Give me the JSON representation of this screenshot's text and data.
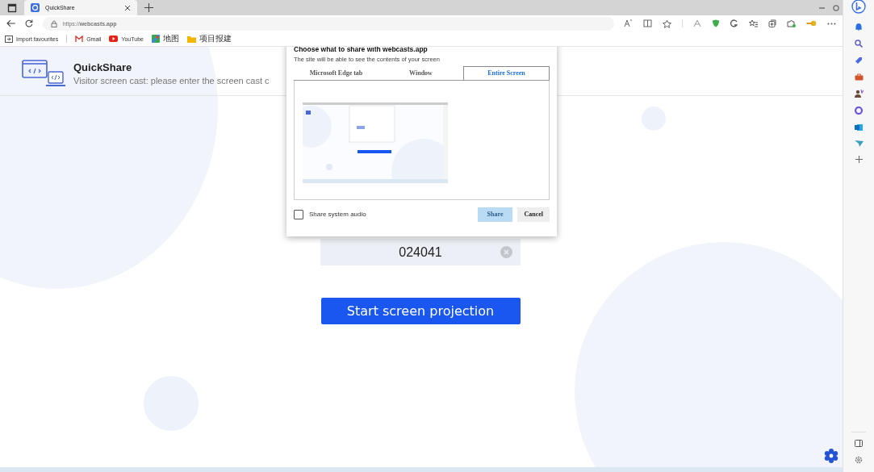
{
  "browser": {
    "tabs": [
      {
        "title": "QuickShare",
        "selected": true
      }
    ],
    "address": "https://**webcasts.app**",
    "bookmarks": [
      {
        "kind": "import",
        "label": "Import favourites"
      },
      {
        "kind": "gmail",
        "label": "Gmail"
      },
      {
        "kind": "youtube",
        "label": "YouTube"
      },
      {
        "kind": "maps",
        "label": "地图"
      },
      {
        "kind": "folder",
        "label": "项目报建"
      }
    ]
  },
  "page": {
    "brand": "QuickShare",
    "subtitle": "Visitor screen cast: please enter the screen cast c",
    "code_field": {
      "value": "024041"
    },
    "start_button": "Start screen projection"
  },
  "dialog": {
    "title": "Choose what to share with webcasts.app",
    "subtitle": "The site will be able to see the contents of your screen",
    "tabs": [
      {
        "label": "Microsoft Edge tab",
        "selected": false
      },
      {
        "label": "Window",
        "selected": false
      },
      {
        "label": "Entire Screen",
        "selected": true
      }
    ],
    "audio_checkbox": {
      "label": "Share system audio",
      "checked": false
    },
    "buttons": [
      {
        "label": "Share",
        "disabled": true
      },
      {
        "label": "Cancel",
        "disabled": false
      }
    ]
  }
}
